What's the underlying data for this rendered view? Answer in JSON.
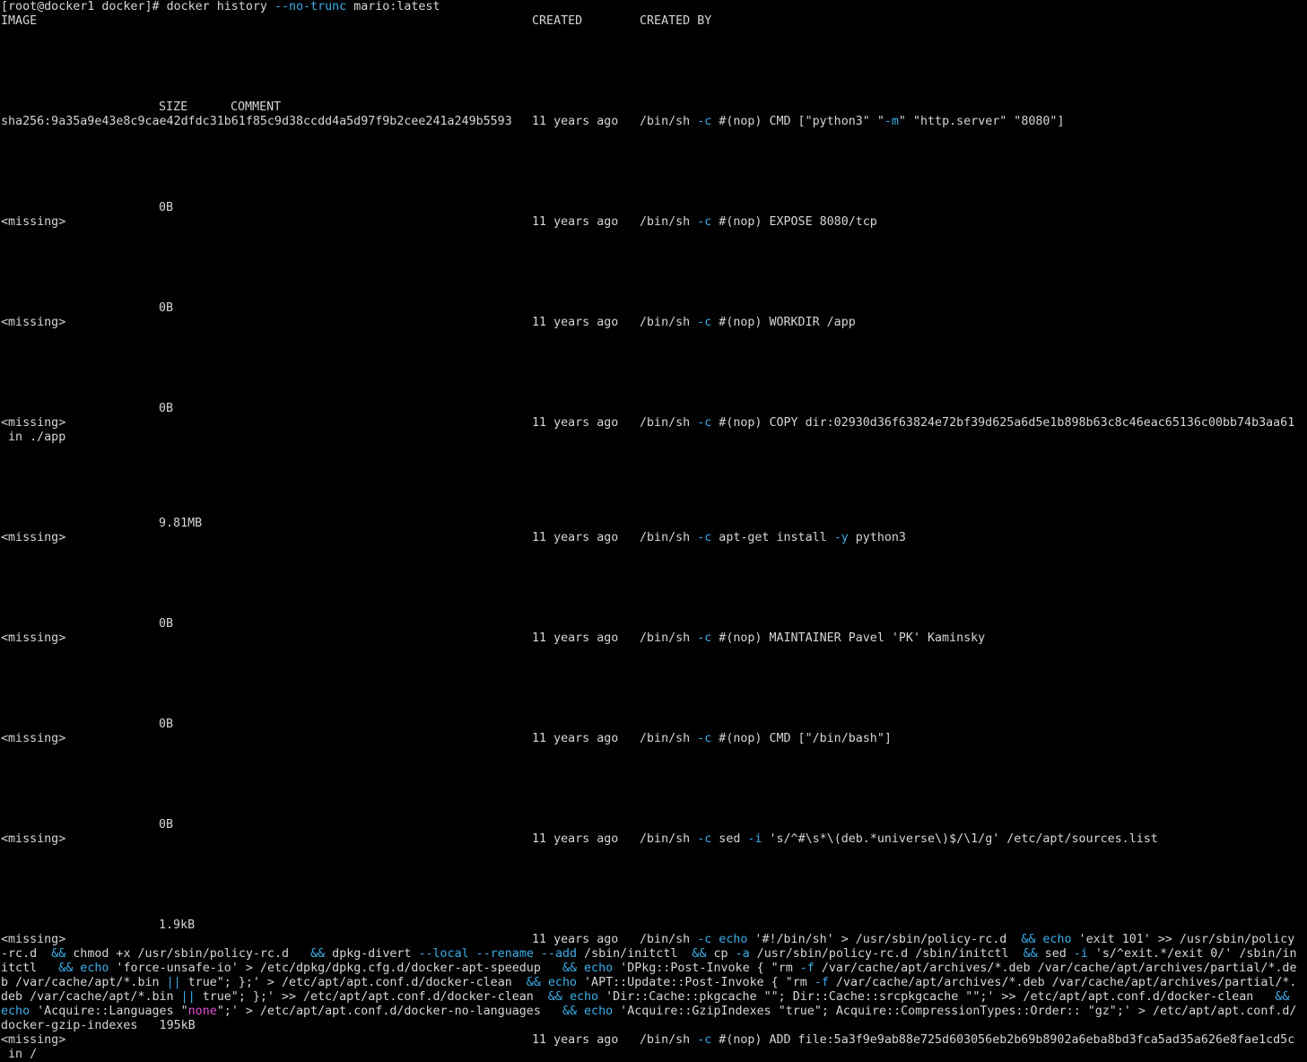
{
  "prompt": {
    "ps1": "[root@docker1 docker]# ",
    "cmd": "docker history ",
    "flag": "--no-trunc",
    "arg": " mario:latest"
  },
  "headers": {
    "image": "IMAGE",
    "created": "CREATED",
    "created_by": "CREATED BY",
    "size": "SIZE",
    "comment": "COMMENT"
  },
  "rows": [
    {
      "image": "sha256:9a35a9e43e8c9cae42dfdc31b61f85c9d38ccdd4a5d97f9b2cee241a249b5593",
      "created": "11 years ago",
      "cmd": [
        "/bin/sh ",
        "-c",
        " #(nop) CMD [\"python3\" \"",
        "-m",
        "\" \"http.server\" \"8080\"]"
      ],
      "size": "0B"
    },
    {
      "image": "<missing>",
      "created": "11 years ago",
      "cmd": [
        "/bin/sh ",
        "-c",
        " #(nop) EXPOSE 8080/tcp"
      ],
      "size": "0B"
    },
    {
      "image": "<missing>",
      "created": "11 years ago",
      "cmd": [
        "/bin/sh ",
        "-c",
        " #(nop) WORKDIR /app"
      ],
      "size": "0B"
    },
    {
      "image": "<missing>",
      "created": "11 years ago",
      "cmd": [
        "/bin/sh ",
        "-c",
        " #(nop) COPY dir:02930d36f63824e72bf39d625a6d5e1b898b63c8c46eac65136c00bb74b3aa61"
      ],
      "cont": " in ./app",
      "size": "9.81MB"
    },
    {
      "image": "<missing>",
      "created": "11 years ago",
      "cmd": [
        "/bin/sh ",
        "-c",
        " apt-get install ",
        "-y",
        " python3"
      ],
      "size": "0B"
    },
    {
      "image": "<missing>",
      "created": "11 years ago",
      "cmd": [
        "/bin/sh ",
        "-c",
        " #(nop) MAINTAINER Pavel 'PK' Kaminsky"
      ],
      "size": "0B"
    },
    {
      "image": "<missing>",
      "created": "11 years ago",
      "cmd": [
        "/bin/sh ",
        "-c",
        " #(nop) CMD [\"/bin/bash\"]"
      ],
      "size": "0B"
    },
    {
      "image": "<missing>",
      "created": "11 years ago",
      "cmd": [
        "/bin/sh ",
        "-c",
        " sed ",
        "-i",
        " 's/^#\\s*\\(deb.*universe\\)$/\\1/g' /etc/apt/sources.list"
      ],
      "size": "1.9kB"
    },
    {
      "image": "<missing>",
      "created": "11 years ago",
      "cmd": [
        "/bin/sh ",
        "-c",
        " ",
        "echo",
        " '#!/bin/sh' > /usr/sbin/policy-rc.d  ",
        "&&",
        " ",
        "echo",
        " 'exit 101' >> /usr/sbin/policy"
      ],
      "wrap": [
        [
          "-rc.d",
          "  ",
          "&&",
          " chmod +x /usr/sbin/policy-rc.d   ",
          "&&",
          " dpkg-divert ",
          "--local",
          " ",
          "--rename",
          " ",
          "--add",
          " /sbin/initctl  ",
          "&&",
          " cp ",
          "-a",
          " /usr/sbin/policy-rc.d /sbin/initctl  ",
          "&&",
          " sed ",
          "-i",
          " 's/^exit.*/exit 0/' /sbin/in"
        ],
        [
          "itctl   ",
          "&&",
          " ",
          "echo",
          " 'force-unsafe-io' > /etc/dpkg/dpkg.cfg.d/docker-apt-speedup   ",
          "&&",
          " ",
          "echo",
          " 'DPkg::Post-Invoke { \"rm ",
          "-f",
          " /var/cache/apt/archives/*.deb /var/cache/apt/archives/partial/*.de"
        ],
        [
          "b /var/cache/apt/*.bin ",
          "||",
          " true\"; };' > /etc/apt/apt.conf.d/docker-clean  ",
          "&&",
          " ",
          "echo",
          " 'APT::Update::Post-Invoke { \"rm ",
          "-f",
          " /var/cache/apt/archives/*.deb /var/cache/apt/archives/partial/*."
        ],
        [
          "deb /var/cache/apt/*.bin ",
          "||",
          " true\"; };' >> /etc/apt/apt.conf.d/docker-clean  ",
          "&&",
          " ",
          "echo",
          " 'Dir::Cache::pkgcache \"\"; Dir::Cache::srcpkgcache \"\";' >> /etc/apt/apt.conf.d/docker-clean   ",
          "&&",
          " "
        ],
        [
          "echo",
          " 'Acquire::Languages \"",
          "none",
          "\";' > /etc/apt/apt.conf.d/docker-no-languages   ",
          "&&",
          " ",
          "echo",
          " 'Acquire::GzipIndexes \"true\"; Acquire::CompressionTypes::Order:: \"gz\";' > /etc/apt/apt.conf.d/"
        ],
        [
          "docker-gzip-indexes",
          "   195kB"
        ]
      ]
    },
    {
      "image": "<missing>",
      "created": "11 years ago",
      "cmd": [
        "/bin/sh ",
        "-c",
        " #(nop) ADD file:5a3f9e9ab88e725d603056eb2b69b8902a6eba8bd3fca5ad35a626e8fae1cd5c"
      ],
      "cont": " in /"
    }
  ],
  "colors": {
    "background": "#000000",
    "foreground": "#d6d6d6",
    "option": "#3daee9",
    "builtin": "#3daee9",
    "string": "#e54fd3"
  }
}
